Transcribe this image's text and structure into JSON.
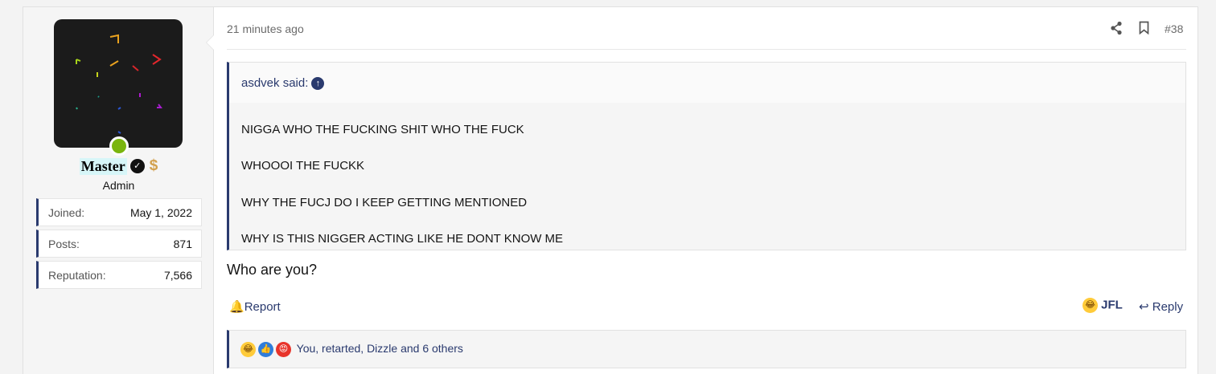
{
  "post": {
    "time": "21 minutes ago",
    "number": "#38",
    "share_icon": "share-icon",
    "bookmark_icon": "bookmark-icon"
  },
  "user": {
    "name": "Master",
    "verified_icon": "check-badge-icon",
    "badge_icon": "dollar-icon",
    "title": "Admin",
    "online": true,
    "stats": [
      {
        "label": "Joined:",
        "value": "May 1, 2022"
      },
      {
        "label": "Posts:",
        "value": "871"
      },
      {
        "label": "Reputation:",
        "value": "7,566"
      }
    ]
  },
  "quote": {
    "author": "asdvek said:",
    "lines": [
      "NIGGA WHO THE FUCKING SHIT WHO THE FUCK",
      "WHOOOI THE FUCKK",
      "WHY THE FUCJ DO I KEEP GETTING MENTIONED",
      "WHY IS THIS NIGGER ACTING LIKE HE DONT KNOW ME"
    ]
  },
  "message": "Who are you?",
  "actions": {
    "report": "Report",
    "jfl": "JFL",
    "reply": "Reply"
  },
  "reactions": {
    "text": "You, retarted, Dizzle and 6 others"
  },
  "colors": {
    "accent": "#2a3a6e",
    "online": "#7ab50e",
    "username_bg": "#d7f6f8"
  }
}
